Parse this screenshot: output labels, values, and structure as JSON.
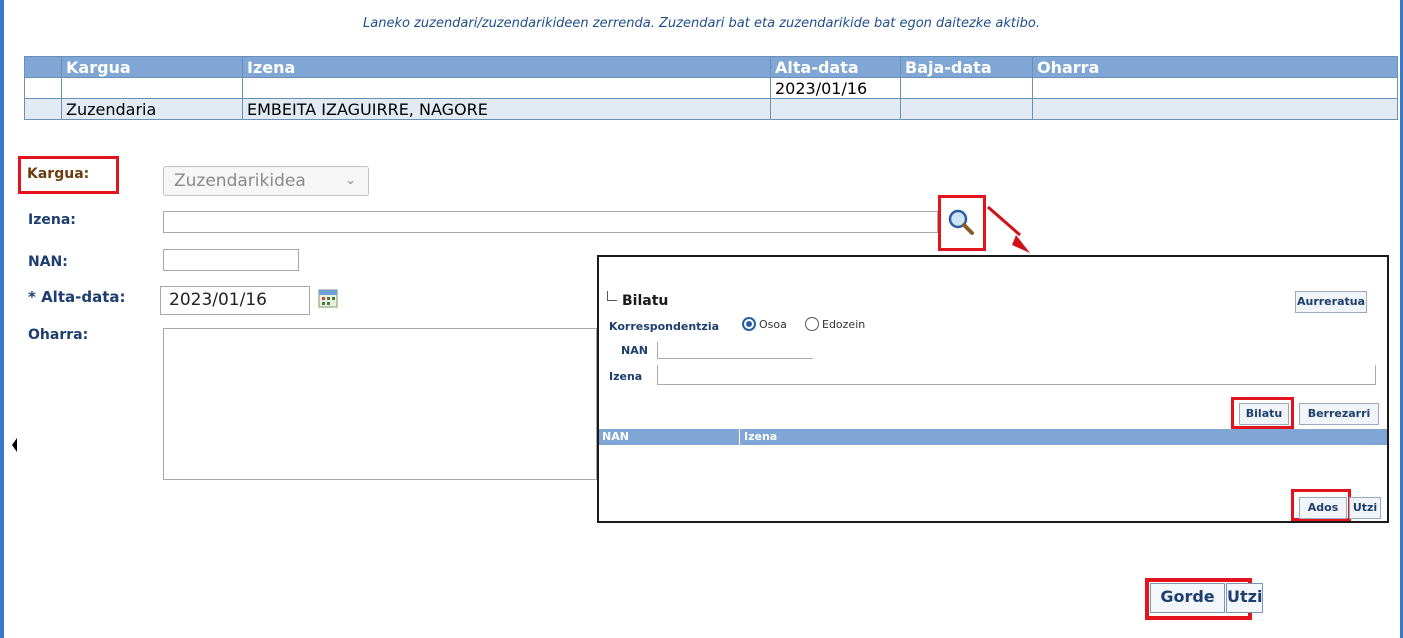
{
  "header": {
    "caption": "Laneko zuzendari/zuzendarikideen zerrenda. Zuzendari bat eta zuzendarikide bat egon daitezke aktibo."
  },
  "table": {
    "columns": [
      "Kargua",
      "Izena",
      "Alta-data",
      "Baja-data",
      "Oharra"
    ],
    "rows": [
      {
        "kargua": "",
        "izena": "",
        "alta": "2023/01/16",
        "baja": "",
        "oharra": ""
      },
      {
        "kargua": "Zuzendaria",
        "izena": "EMBEITA IZAGUIRRE, NAGORE",
        "alta": "",
        "baja": "",
        "oharra": ""
      }
    ]
  },
  "form": {
    "kargua_label": "Kargua:",
    "kargua_value": "Zuzendarikidea",
    "izena_label": "Izena:",
    "nan_label": "NAN:",
    "alta_label": "* Alta-data:",
    "alta_value": "2023/01/16",
    "oharra_label": "Oharra:"
  },
  "popup": {
    "title": "Bilatu",
    "advanced_button": "Aurreratua",
    "correspondence_label": "Korrespondentzia",
    "option_exact": "Osoa",
    "option_any": "Edozein",
    "nan_label": "NAN",
    "izena_label": "Izena",
    "search_button": "Bilatu",
    "reset_button": "Berrezarri",
    "results_columns": [
      "NAN",
      "Izena"
    ],
    "ok_button": "Ados",
    "cancel_button": "Utzi"
  },
  "footer": {
    "save_button": "Gorde",
    "cancel_button": "Utzi"
  },
  "colors": {
    "accent_blue": "#3a78c9",
    "header_blue": "#7fa6d4",
    "highlight_red": "#e3141e"
  }
}
